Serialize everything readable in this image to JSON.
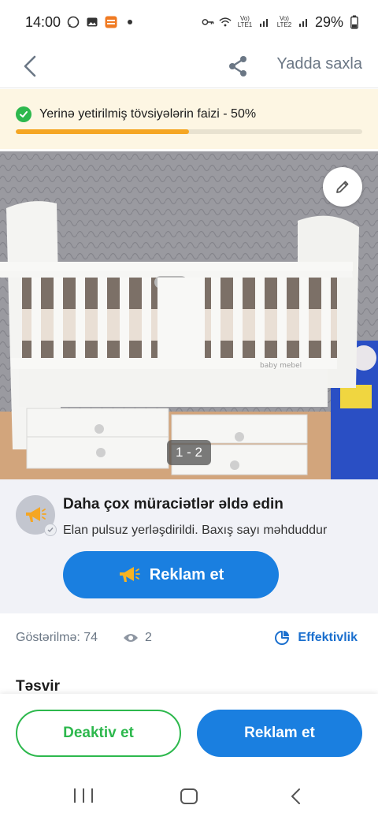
{
  "status_bar": {
    "time": "14:00",
    "sim1": "Vo) LTE1",
    "sim2": "Vo) LTE2",
    "battery": "29%",
    "icons": [
      "whatsapp-icon",
      "gallery-icon",
      "app-notification-icon",
      "dot-icon",
      "key-icon",
      "wifi-icon",
      "signal-icon",
      "battery-icon"
    ]
  },
  "header": {
    "back_icon": "chevron-left-icon",
    "share_icon": "share-icon",
    "save_label": "Yadda saxla"
  },
  "progress_banner": {
    "text": "Yerinə yetirilmiş tövsiyələrin faizi - 50%",
    "percent": 50,
    "fill_color": "#f5a623",
    "check_color": "#2db84d"
  },
  "photo": {
    "counter": "1 - 2",
    "edit_icon": "pencil-icon",
    "crib_label": "baby mebel"
  },
  "promo": {
    "title": "Daha çox müraciətlər əldə edin",
    "subtitle": "Elan pulsuz yerləşdirildi. Baxış sayı məhduddur",
    "button_label": "Reklam et",
    "button_icon": "megaphone-icon"
  },
  "stats": {
    "impressions_label": "Göstərilmə: 74",
    "views_count": "2",
    "effect_label": "Effektivlik"
  },
  "section": {
    "description_title": "Təsvir"
  },
  "actions": {
    "deactivate_label": "Deaktiv et",
    "advertise_label": "Reklam et"
  },
  "colors": {
    "primary_blue": "#1a7fe0",
    "success_green": "#2db84d",
    "banner_bg": "#fdf6e3",
    "promo_bg": "#f1f2f7"
  }
}
